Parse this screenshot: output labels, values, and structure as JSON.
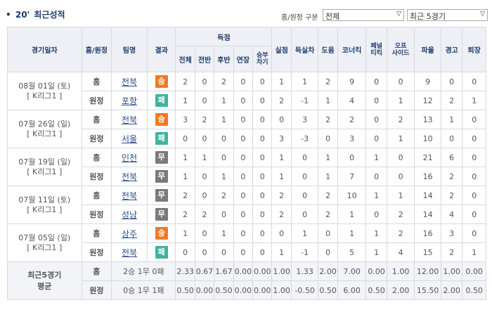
{
  "header": {
    "bullet": "•",
    "year": "20'",
    "title": "최근성적",
    "filter_label": "홈/원정 구분",
    "filter_home_away": "전체",
    "filter_range": "최근 5경기",
    "dropdown_arrow": "▽"
  },
  "table": {
    "headers": {
      "date": "경기일자",
      "home_away": "홈/원정",
      "team": "팀명",
      "result": "결과",
      "goals_group": "득점",
      "goals_sub": [
        "전체",
        "전반",
        "후반",
        "연장",
        "승부\n차기"
      ],
      "others": [
        "실점",
        "득실차",
        "도움",
        "코너킥",
        "페널\n티킥",
        "오프\n사이드",
        "파울",
        "경고",
        "퇴장"
      ]
    },
    "games": [
      {
        "date": "08월 01일 (토)",
        "league": "[ K리그1 ]",
        "rows": [
          {
            "ha": "홈",
            "team": "전북",
            "result": "승",
            "result_type": "w",
            "stats": [
              "2",
              "0",
              "2",
              "0",
              "0",
              "1",
              "1",
              "2",
              "9",
              "0",
              "0",
              "9",
              "0",
              "0"
            ]
          },
          {
            "ha": "원정",
            "team": "포항",
            "result": "패",
            "result_type": "l",
            "stats": [
              "1",
              "0",
              "1",
              "0",
              "0",
              "2",
              "-1",
              "1",
              "4",
              "0",
              "1",
              "12",
              "2",
              "1"
            ]
          }
        ]
      },
      {
        "date": "07월 26일 (일)",
        "league": "[ K리그1 ]",
        "rows": [
          {
            "ha": "홈",
            "team": "전북",
            "result": "승",
            "result_type": "w",
            "stats": [
              "3",
              "2",
              "1",
              "0",
              "0",
              "0",
              "3",
              "2",
              "2",
              "0",
              "2",
              "13",
              "1",
              "0"
            ]
          },
          {
            "ha": "원정",
            "team": "서울",
            "result": "패",
            "result_type": "l",
            "stats": [
              "0",
              "0",
              "0",
              "0",
              "0",
              "3",
              "-3",
              "0",
              "3",
              "0",
              "1",
              "10",
              "0",
              "0"
            ]
          }
        ]
      },
      {
        "date": "07월 19일 (일)",
        "league": "[ K리그1 ]",
        "rows": [
          {
            "ha": "홈",
            "team": "인천",
            "result": "무",
            "result_type": "d",
            "stats": [
              "1",
              "1",
              "0",
              "0",
              "0",
              "1",
              "0",
              "1",
              "0",
              "1",
              "0",
              "21",
              "6",
              "0"
            ]
          },
          {
            "ha": "원정",
            "team": "전북",
            "result": "무",
            "result_type": "d",
            "stats": [
              "1",
              "0",
              "1",
              "0",
              "0",
              "1",
              "0",
              "1",
              "7",
              "0",
              "0",
              "16",
              "2",
              "0"
            ]
          }
        ]
      },
      {
        "date": "07월 11일 (토)",
        "league": "[ K리그1 ]",
        "rows": [
          {
            "ha": "홈",
            "team": "전북",
            "result": "무",
            "result_type": "d",
            "stats": [
              "2",
              "0",
              "2",
              "0",
              "0",
              "2",
              "0",
              "2",
              "10",
              "1",
              "1",
              "14",
              "2",
              "0"
            ]
          },
          {
            "ha": "원정",
            "team": "성남",
            "result": "무",
            "result_type": "d",
            "stats": [
              "2",
              "2",
              "0",
              "0",
              "0",
              "2",
              "0",
              "2",
              "1",
              "0",
              "2",
              "14",
              "4",
              "0"
            ]
          }
        ]
      },
      {
        "date": "07월 05일 (일)",
        "league": "[ K리그1 ]",
        "rows": [
          {
            "ha": "홈",
            "team": "상주",
            "result": "승",
            "result_type": "w",
            "stats": [
              "1",
              "0",
              "1",
              "0",
              "0",
              "0",
              "1",
              "0",
              "1",
              "1",
              "2",
              "16",
              "3",
              "0"
            ]
          },
          {
            "ha": "원정",
            "team": "전북",
            "result": "패",
            "result_type": "l",
            "stats": [
              "0",
              "0",
              "0",
              "0",
              "0",
              "1",
              "-1",
              "0",
              "5",
              "1",
              "4",
              "15",
              "2",
              "1"
            ]
          }
        ]
      }
    ],
    "average": {
      "title": "최근5경기\n평균",
      "rows": [
        {
          "ha": "홈",
          "summary": "2승 1무 0패",
          "stats": [
            "2.33",
            "0.67",
            "1.67",
            "0.00",
            "0.00",
            "1.00",
            "1.33",
            "2.00",
            "7.00",
            "0.00",
            "1.00",
            "12.00",
            "1.00",
            "0.00"
          ]
        },
        {
          "ha": "원정",
          "summary": "0승 1무 1패",
          "stats": [
            "0.50",
            "0.00",
            "0.50",
            "0.00",
            "0.00",
            "1.00",
            "-0.50",
            "0.50",
            "6.00",
            "0.50",
            "2.00",
            "15.50",
            "2.00",
            "0.50"
          ]
        }
      ]
    }
  },
  "colors": {
    "win": "#f07a25",
    "loss": "#3fb39f",
    "draw": "#7a7a7a",
    "header_text": "#1f3d6e"
  }
}
